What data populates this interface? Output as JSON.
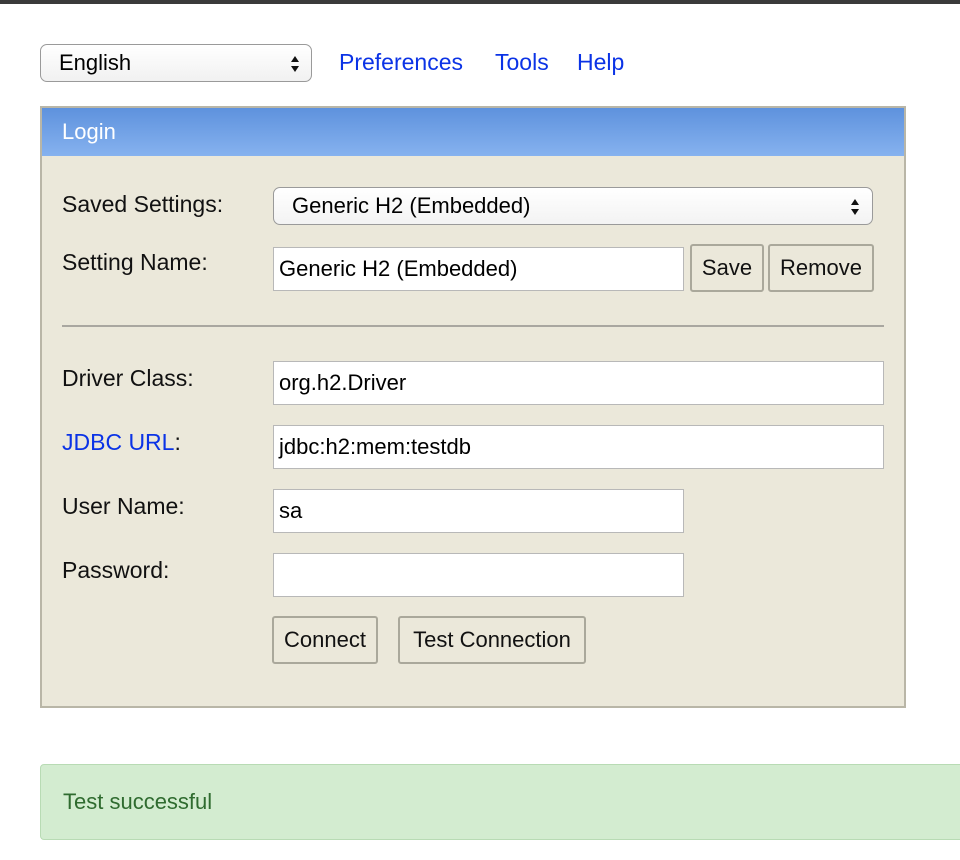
{
  "header": {
    "language": {
      "selected": "English"
    },
    "links": {
      "preferences": "Preferences",
      "tools": "Tools",
      "help": "Help"
    }
  },
  "login": {
    "title": "Login",
    "saved_settings": {
      "label": "Saved Settings:",
      "value": "Generic H2 (Embedded)"
    },
    "setting_name": {
      "label": "Setting Name:",
      "value": "Generic H2 (Embedded)"
    },
    "buttons": {
      "save": "Save",
      "remove": "Remove",
      "connect": "Connect",
      "test_connection": "Test Connection"
    },
    "driver_class": {
      "label": "Driver Class:",
      "value": "org.h2.Driver"
    },
    "jdbc_url": {
      "label_link": "JDBC URL",
      "label_suffix": ":",
      "value": "jdbc:h2:mem:testdb"
    },
    "user_name": {
      "label": "User Name:",
      "value": "sa"
    },
    "password": {
      "label": "Password:",
      "value": ""
    }
  },
  "status": {
    "message": "Test successful"
  },
  "colors": {
    "panel_bg": "#ebe8da",
    "header_gradient_top": "#5e92dd",
    "header_gradient_bottom": "#86b2ef",
    "link": "#0b33e6",
    "status_bg": "#d3ecd0",
    "status_text": "#2f6b2f"
  }
}
